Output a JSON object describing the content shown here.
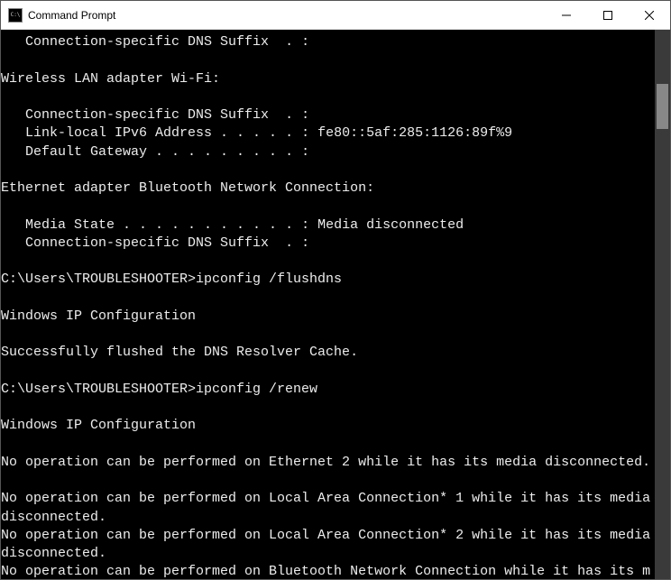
{
  "window": {
    "title": "Command Prompt"
  },
  "console": {
    "lines": [
      "   Connection-specific DNS Suffix  . :",
      "",
      "Wireless LAN adapter Wi-Fi:",
      "",
      "   Connection-specific DNS Suffix  . :",
      "   Link-local IPv6 Address . . . . . : fe80::5af:285:1126:89f%9",
      "   Default Gateway . . . . . . . . . :",
      "",
      "Ethernet adapter Bluetooth Network Connection:",
      "",
      "   Media State . . . . . . . . . . . : Media disconnected",
      "   Connection-specific DNS Suffix  . :",
      "",
      "C:\\Users\\TROUBLESHOOTER>ipconfig /flushdns",
      "",
      "Windows IP Configuration",
      "",
      "Successfully flushed the DNS Resolver Cache.",
      "",
      "C:\\Users\\TROUBLESHOOTER>ipconfig /renew",
      "",
      "Windows IP Configuration",
      "",
      "No operation can be performed on Ethernet 2 while it has its media disconnected.",
      "",
      "No operation can be performed on Local Area Connection* 1 while it has its media disconnected.",
      "No operation can be performed on Local Area Connection* 2 while it has its media disconnected.",
      "No operation can be performed on Bluetooth Network Connection while it has its m"
    ]
  }
}
